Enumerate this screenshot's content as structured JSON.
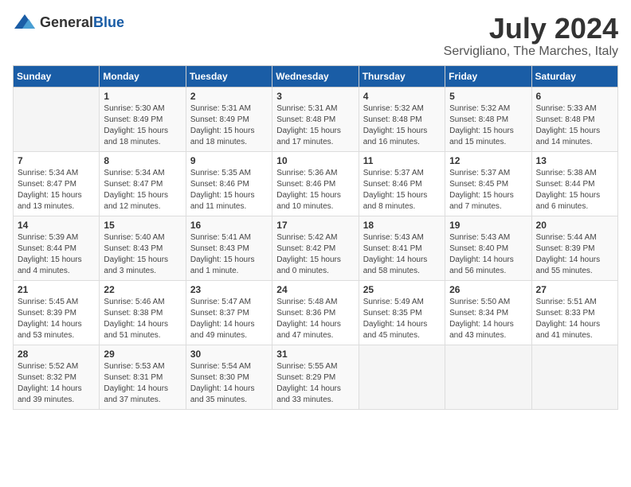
{
  "header": {
    "logo_general": "General",
    "logo_blue": "Blue",
    "month_title": "July 2024",
    "location": "Servigliano, The Marches, Italy"
  },
  "calendar": {
    "days_of_week": [
      "Sunday",
      "Monday",
      "Tuesday",
      "Wednesday",
      "Thursday",
      "Friday",
      "Saturday"
    ],
    "weeks": [
      [
        {
          "day": "",
          "info": ""
        },
        {
          "day": "1",
          "info": "Sunrise: 5:30 AM\nSunset: 8:49 PM\nDaylight: 15 hours\nand 18 minutes."
        },
        {
          "day": "2",
          "info": "Sunrise: 5:31 AM\nSunset: 8:49 PM\nDaylight: 15 hours\nand 18 minutes."
        },
        {
          "day": "3",
          "info": "Sunrise: 5:31 AM\nSunset: 8:48 PM\nDaylight: 15 hours\nand 17 minutes."
        },
        {
          "day": "4",
          "info": "Sunrise: 5:32 AM\nSunset: 8:48 PM\nDaylight: 15 hours\nand 16 minutes."
        },
        {
          "day": "5",
          "info": "Sunrise: 5:32 AM\nSunset: 8:48 PM\nDaylight: 15 hours\nand 15 minutes."
        },
        {
          "day": "6",
          "info": "Sunrise: 5:33 AM\nSunset: 8:48 PM\nDaylight: 15 hours\nand 14 minutes."
        }
      ],
      [
        {
          "day": "7",
          "info": "Sunrise: 5:34 AM\nSunset: 8:47 PM\nDaylight: 15 hours\nand 13 minutes."
        },
        {
          "day": "8",
          "info": "Sunrise: 5:34 AM\nSunset: 8:47 PM\nDaylight: 15 hours\nand 12 minutes."
        },
        {
          "day": "9",
          "info": "Sunrise: 5:35 AM\nSunset: 8:46 PM\nDaylight: 15 hours\nand 11 minutes."
        },
        {
          "day": "10",
          "info": "Sunrise: 5:36 AM\nSunset: 8:46 PM\nDaylight: 15 hours\nand 10 minutes."
        },
        {
          "day": "11",
          "info": "Sunrise: 5:37 AM\nSunset: 8:46 PM\nDaylight: 15 hours\nand 8 minutes."
        },
        {
          "day": "12",
          "info": "Sunrise: 5:37 AM\nSunset: 8:45 PM\nDaylight: 15 hours\nand 7 minutes."
        },
        {
          "day": "13",
          "info": "Sunrise: 5:38 AM\nSunset: 8:44 PM\nDaylight: 15 hours\nand 6 minutes."
        }
      ],
      [
        {
          "day": "14",
          "info": "Sunrise: 5:39 AM\nSunset: 8:44 PM\nDaylight: 15 hours\nand 4 minutes."
        },
        {
          "day": "15",
          "info": "Sunrise: 5:40 AM\nSunset: 8:43 PM\nDaylight: 15 hours\nand 3 minutes."
        },
        {
          "day": "16",
          "info": "Sunrise: 5:41 AM\nSunset: 8:43 PM\nDaylight: 15 hours\nand 1 minute."
        },
        {
          "day": "17",
          "info": "Sunrise: 5:42 AM\nSunset: 8:42 PM\nDaylight: 15 hours\nand 0 minutes."
        },
        {
          "day": "18",
          "info": "Sunrise: 5:43 AM\nSunset: 8:41 PM\nDaylight: 14 hours\nand 58 minutes."
        },
        {
          "day": "19",
          "info": "Sunrise: 5:43 AM\nSunset: 8:40 PM\nDaylight: 14 hours\nand 56 minutes."
        },
        {
          "day": "20",
          "info": "Sunrise: 5:44 AM\nSunset: 8:39 PM\nDaylight: 14 hours\nand 55 minutes."
        }
      ],
      [
        {
          "day": "21",
          "info": "Sunrise: 5:45 AM\nSunset: 8:39 PM\nDaylight: 14 hours\nand 53 minutes."
        },
        {
          "day": "22",
          "info": "Sunrise: 5:46 AM\nSunset: 8:38 PM\nDaylight: 14 hours\nand 51 minutes."
        },
        {
          "day": "23",
          "info": "Sunrise: 5:47 AM\nSunset: 8:37 PM\nDaylight: 14 hours\nand 49 minutes."
        },
        {
          "day": "24",
          "info": "Sunrise: 5:48 AM\nSunset: 8:36 PM\nDaylight: 14 hours\nand 47 minutes."
        },
        {
          "day": "25",
          "info": "Sunrise: 5:49 AM\nSunset: 8:35 PM\nDaylight: 14 hours\nand 45 minutes."
        },
        {
          "day": "26",
          "info": "Sunrise: 5:50 AM\nSunset: 8:34 PM\nDaylight: 14 hours\nand 43 minutes."
        },
        {
          "day": "27",
          "info": "Sunrise: 5:51 AM\nSunset: 8:33 PM\nDaylight: 14 hours\nand 41 minutes."
        }
      ],
      [
        {
          "day": "28",
          "info": "Sunrise: 5:52 AM\nSunset: 8:32 PM\nDaylight: 14 hours\nand 39 minutes."
        },
        {
          "day": "29",
          "info": "Sunrise: 5:53 AM\nSunset: 8:31 PM\nDaylight: 14 hours\nand 37 minutes."
        },
        {
          "day": "30",
          "info": "Sunrise: 5:54 AM\nSunset: 8:30 PM\nDaylight: 14 hours\nand 35 minutes."
        },
        {
          "day": "31",
          "info": "Sunrise: 5:55 AM\nSunset: 8:29 PM\nDaylight: 14 hours\nand 33 minutes."
        },
        {
          "day": "",
          "info": ""
        },
        {
          "day": "",
          "info": ""
        },
        {
          "day": "",
          "info": ""
        }
      ]
    ]
  }
}
